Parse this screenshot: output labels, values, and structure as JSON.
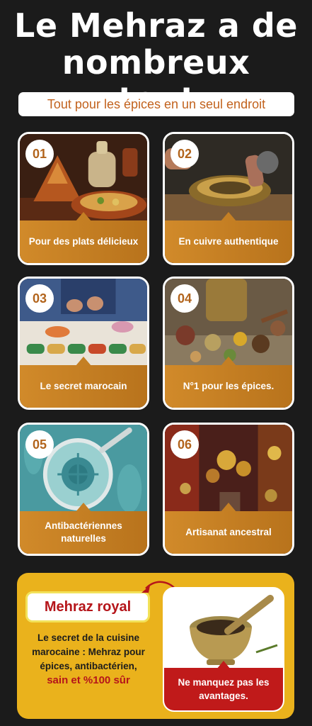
{
  "heading": {
    "line1": "Le Mehraz a de",
    "line2": "nombreux atouts",
    "subtitle": "Tout pour les épices en un seul endroit"
  },
  "features": [
    {
      "number": "01",
      "label": "Pour des plats délicieux"
    },
    {
      "number": "02",
      "label": "En cuivre authentique"
    },
    {
      "number": "03",
      "label": "Le secret marocain"
    },
    {
      "number": "04",
      "label": "N°1 pour les épices."
    },
    {
      "number": "05",
      "label": "Antibactériennes naturelles"
    },
    {
      "number": "06",
      "label": "Artisanat ancestral"
    }
  ],
  "promo": {
    "badge": "Mehraz royal",
    "description": "Le secret de la cuisine marocaine : Mehraz pour épices, antibactérien,",
    "highlight": "sain et %100 sûr",
    "cta": "Ne manquez pas les avantages."
  },
  "colors": {
    "background": "#1b1b1b",
    "accent": "#c47f24",
    "promo_bg": "#eab21c",
    "red": "#b5151a"
  }
}
